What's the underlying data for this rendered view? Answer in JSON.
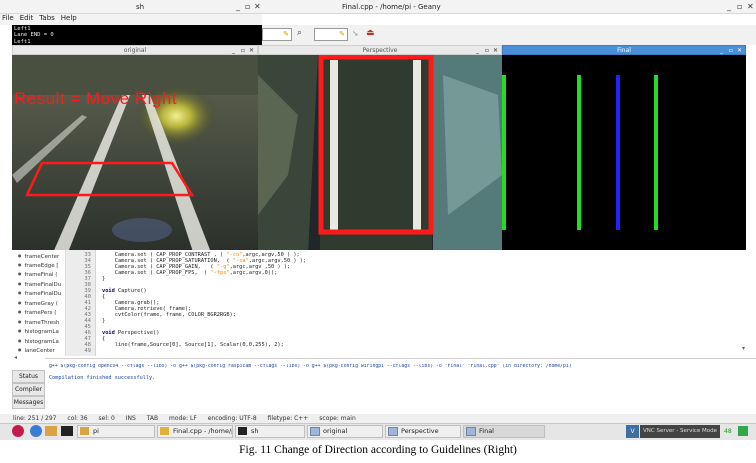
{
  "terminal": {
    "title": "sh",
    "menu": [
      "File",
      "Edit",
      "Tabs",
      "Help"
    ],
    "output": [
      "Left1",
      "Lane END = 0",
      "Left1"
    ]
  },
  "geany": {
    "title": "Final.cpp - /home/pi - Geany"
  },
  "windows": {
    "original": {
      "title": "original",
      "overlay_text": "Result = Move Right"
    },
    "perspective": {
      "title": "Perspective"
    },
    "final": {
      "title": "Final"
    }
  },
  "window_controls": {
    "minimize": "_",
    "maximize": "▫",
    "close": "✕"
  },
  "symbols": [
    "frameCenter",
    "frameEdge [",
    "frameFinal (",
    "frameFinalDu",
    "frameFinalDu",
    "frameGray (",
    "framePers (",
    "frameThresh",
    "histogramLa",
    "histogramLa",
    "laneCenter"
  ],
  "line_numbers": [
    "33",
    "34",
    "35",
    "36",
    "37",
    "38",
    "39",
    "40",
    "41",
    "42",
    "43",
    "44",
    "45",
    "46",
    "47",
    "48",
    "49"
  ],
  "code": {
    "l33": {
      "pre": "    Camera.set ( CAP_PROP_CONTRAST , ( ",
      "s": "\"-co\"",
      "post": ",argc,argv,50 ) );"
    },
    "l34": {
      "pre": "    Camera.set ( CAP_PROP_SATURATION,  ( ",
      "s": "\"-sa\"",
      "post": ",argc,argv,50 ) );"
    },
    "l35": {
      "pre": "    Camera.set ( CAP_PROP_GAIN,   ( ",
      "s": "\"-g\"",
      "post": ",argc,argv ,50 ) );"
    },
    "l36": {
      "pre": "    Camera.set ( CAP_PROP_FPS,  ( ",
      "s": "\"-fps\"",
      "post": ",argc,argv,0));"
    },
    "l37": "}",
    "l39_kw": "void",
    "l39_rest": " Capture()",
    "l40": "{",
    "l41": "    Camera.grab();",
    "l42": "    Camera.retrieve( frame);",
    "l43": "    cvtColor(frame, frame, COLOR_BGR2RGB);",
    "l44": "}",
    "l46_kw": "void",
    "l46_rest": " Perspective()",
    "l47": "{",
    "l48": "    line(frame,Source[0], Source[1], Scalar(0,0,255), 2);"
  },
  "messages": [
    "g++ $(pkg-config opencv4 --cflags --libs) -o g++ $(pkg-config raspicam --cflags --libs) -o g++ $(pkg-config wiringpi --cflags --libs) -o \"Final\" \"Final.cpp\" (in directory: /home/pi)",
    "Compilation finished successfully."
  ],
  "msg_tabs": [
    "Status",
    "Compiler",
    "Messages"
  ],
  "statusbar": [
    "line: 251 / 297",
    "col: 36",
    "sel: 0",
    "INS",
    "TAB",
    "mode: LF",
    "encoding: UTF-8",
    "filetype: C++",
    "scope: main"
  ],
  "taskbar": {
    "items": [
      "pi",
      "Final.cpp - /home/pi - ...",
      "sh",
      "original",
      "Perspective",
      "Final"
    ],
    "vnc": "VNC Server - Service Mode",
    "tray": "48"
  },
  "caption": "Fig. 11 Change of Direction according to Guidelines (Right)",
  "colors": {
    "overlay_red": "#ff1a1a",
    "lane_green": "#22dd22",
    "center_blue": "#2222ff",
    "active_title": "#4a90d9"
  }
}
